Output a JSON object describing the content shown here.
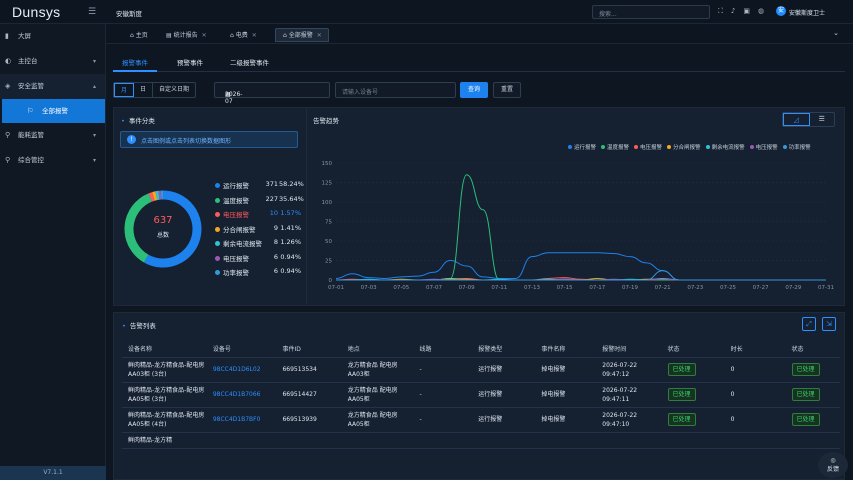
{
  "brand": "Dunsys",
  "site_name": "安徽斯度",
  "search": {
    "placeholder": "搜索..."
  },
  "user": {
    "name": "安徽斯度卫士",
    "avatar": "安"
  },
  "top_icons": [
    "fullscreen-icon",
    "bell-icon",
    "lock-icon",
    "globe-icon"
  ],
  "sidebar": {
    "items": [
      {
        "label": "大屏",
        "icon": "monitor-icon"
      },
      {
        "label": "主控台",
        "icon": "gauge-icon"
      },
      {
        "label": "安全监管",
        "icon": "shield-icon"
      },
      {
        "label": "全部报警",
        "icon": "alarm-icon"
      },
      {
        "label": "能耗监管",
        "icon": "pin-icon"
      },
      {
        "label": "综合管控",
        "icon": "pin-icon"
      }
    ],
    "version": "V7.1.1"
  },
  "tabs": [
    {
      "label": "主页"
    },
    {
      "label": "统计报告"
    },
    {
      "label": "电费"
    },
    {
      "label": "全部报警"
    }
  ],
  "subtabs": [
    {
      "label": "报警事件"
    },
    {
      "label": "预警事件"
    },
    {
      "label": "二级报警事件"
    }
  ],
  "filter": {
    "seg": [
      "月",
      "日",
      "自定义日期"
    ],
    "date_value": "2026-07",
    "device_placeholder": "请输入设备号",
    "query": "查询",
    "reset": "重置"
  },
  "event_panel": {
    "title": "事件分类",
    "notice": "点击图例或点击列表切换数据图形",
    "total": "637",
    "total_label": "总数"
  },
  "categories": [
    {
      "name": "运行报警",
      "count": "371",
      "pct": "58.24%",
      "color": "#1e82ee"
    },
    {
      "name": "温度报警",
      "count": "227",
      "pct": "35.64%",
      "color": "#2bbf7a"
    },
    {
      "name": "电压报警",
      "count": "10",
      "pct": "1.57%",
      "color": "#ff5b5b"
    },
    {
      "name": "分合闸报警",
      "count": "9",
      "pct": "1.41%",
      "color": "#f5a623"
    },
    {
      "name": "剩余电流报警",
      "count": "8",
      "pct": "1.26%",
      "color": "#2ec4d6"
    },
    {
      "name": "电压报警",
      "count": "6",
      "pct": "0.94%",
      "color": "#9b59b6"
    },
    {
      "name": "功率报警",
      "count": "6",
      "pct": "0.94%",
      "color": "#3498db"
    }
  ],
  "trend_panel": {
    "title": "告警趋势"
  },
  "chart_data": {
    "type": "line",
    "x": [
      "07-01",
      "07-02",
      "07-03",
      "07-04",
      "07-05",
      "07-06",
      "07-07",
      "07-08",
      "07-09",
      "07-10",
      "07-11",
      "07-12",
      "07-13",
      "07-14",
      "07-15",
      "07-16",
      "07-17",
      "07-18",
      "07-19",
      "07-20",
      "07-21",
      "07-22",
      "07-23",
      "07-24",
      "07-25",
      "07-26",
      "07-27",
      "07-28",
      "07-29",
      "07-30",
      "07-31"
    ],
    "xticks": [
      "07-01",
      "07-03",
      "07-05",
      "07-07",
      "07-09",
      "07-11",
      "07-13",
      "07-15",
      "07-17",
      "07-19",
      "07-21",
      "07-23",
      "07-25",
      "07-27",
      "07-29",
      "07-31"
    ],
    "ylim": [
      0,
      150
    ],
    "yticks": [
      0,
      25,
      50,
      75,
      100,
      125,
      150
    ],
    "series": [
      {
        "name": "运行报警",
        "color": "#1e82ee",
        "values": [
          2,
          8,
          3,
          2,
          4,
          5,
          10,
          25,
          18,
          4,
          2,
          2,
          30,
          35,
          35,
          35,
          35,
          34,
          30,
          22,
          12,
          0,
          0,
          0,
          0,
          0,
          0,
          0,
          0,
          0,
          0
        ]
      },
      {
        "name": "温度报警",
        "color": "#2bbf7a",
        "values": [
          0,
          0,
          0,
          0,
          0,
          0,
          0,
          2,
          135,
          90,
          0,
          0,
          0,
          0,
          0,
          0,
          0,
          0,
          0,
          0,
          0,
          0,
          0,
          0,
          0,
          0,
          0,
          0,
          0,
          0,
          0
        ]
      },
      {
        "name": "电压报警",
        "color": "#ff5b5b",
        "values": [
          0,
          1,
          0,
          0,
          0,
          0,
          0,
          1,
          2,
          0,
          0,
          0,
          0,
          2,
          3,
          1,
          0,
          0,
          0,
          0,
          1,
          0,
          0,
          0,
          0,
          0,
          0,
          0,
          0,
          0,
          0
        ]
      },
      {
        "name": "分合闸报警",
        "color": "#f5a623",
        "values": [
          0,
          0,
          0,
          0,
          1,
          0,
          0,
          2,
          1,
          0,
          0,
          0,
          0,
          0,
          1,
          0,
          2,
          0,
          0,
          1,
          1,
          0,
          0,
          0,
          0,
          0,
          0,
          0,
          0,
          0,
          0
        ]
      },
      {
        "name": "剩余电流报警",
        "color": "#2ec4d6",
        "values": [
          0,
          0,
          1,
          0,
          0,
          0,
          0,
          1,
          0,
          0,
          1,
          0,
          0,
          1,
          0,
          0,
          0,
          0,
          1,
          0,
          2,
          0,
          0,
          0,
          0,
          0,
          0,
          0,
          0,
          0,
          0
        ]
      },
      {
        "name": "电压报警",
        "color": "#9b59b6",
        "values": [
          0,
          0,
          0,
          0,
          0,
          0,
          1,
          0,
          0,
          0,
          0,
          0,
          0,
          0,
          1,
          0,
          0,
          1,
          0,
          0,
          1,
          0,
          0,
          0,
          0,
          0,
          0,
          0,
          0,
          0,
          0
        ]
      },
      {
        "name": "功率报警",
        "color": "#3498db",
        "values": [
          0,
          0,
          0,
          0,
          0,
          0,
          0,
          0,
          0,
          0,
          0,
          0,
          0,
          0,
          0,
          0,
          0,
          0,
          0,
          0,
          12,
          0,
          0,
          0,
          0,
          0,
          0,
          0,
          0,
          0,
          0
        ]
      }
    ]
  },
  "alarm_list": {
    "title": "告警列表",
    "columns": [
      "设备名称",
      "设备号",
      "事件ID",
      "地点",
      "线路",
      "报警类型",
      "事件名称",
      "报警时间",
      "状态",
      "时长",
      "状态"
    ],
    "rows": [
      [
        "鲜肉精品-龙方精食品-配电房AA03柜 (3台)",
        "98CC4D1D6L02",
        "669513534",
        "龙方精食品 配电房 AA03柜",
        "-",
        "运行报警",
        "掉电报警",
        "2026-07-22 09:47:12",
        "已处理",
        "0",
        "已处理"
      ],
      [
        "鲜肉精品-龙方精食品-配电房AA05柜 (3台)",
        "98CC4D1B7066",
        "669514427",
        "龙方精食品 配电房 AA05柜",
        "-",
        "运行报警",
        "掉电报警",
        "2026-07-22 09:47:11",
        "已处理",
        "0",
        "已处理"
      ],
      [
        "鲜肉精品-龙方精食品-配电房AA05柜 (4台)",
        "98CC4D1B7BF0",
        "669513939",
        "龙方精食品 配电房 AA05柜",
        "-",
        "运行报警",
        "掉电报警",
        "2026-07-22 09:47:10",
        "已处理",
        "0",
        "已处理"
      ],
      [
        "鲜肉精品-龙方精",
        "",
        "",
        "",
        "",
        "",
        "",
        "",
        "",
        "",
        ""
      ]
    ]
  },
  "feedback": "反馈"
}
